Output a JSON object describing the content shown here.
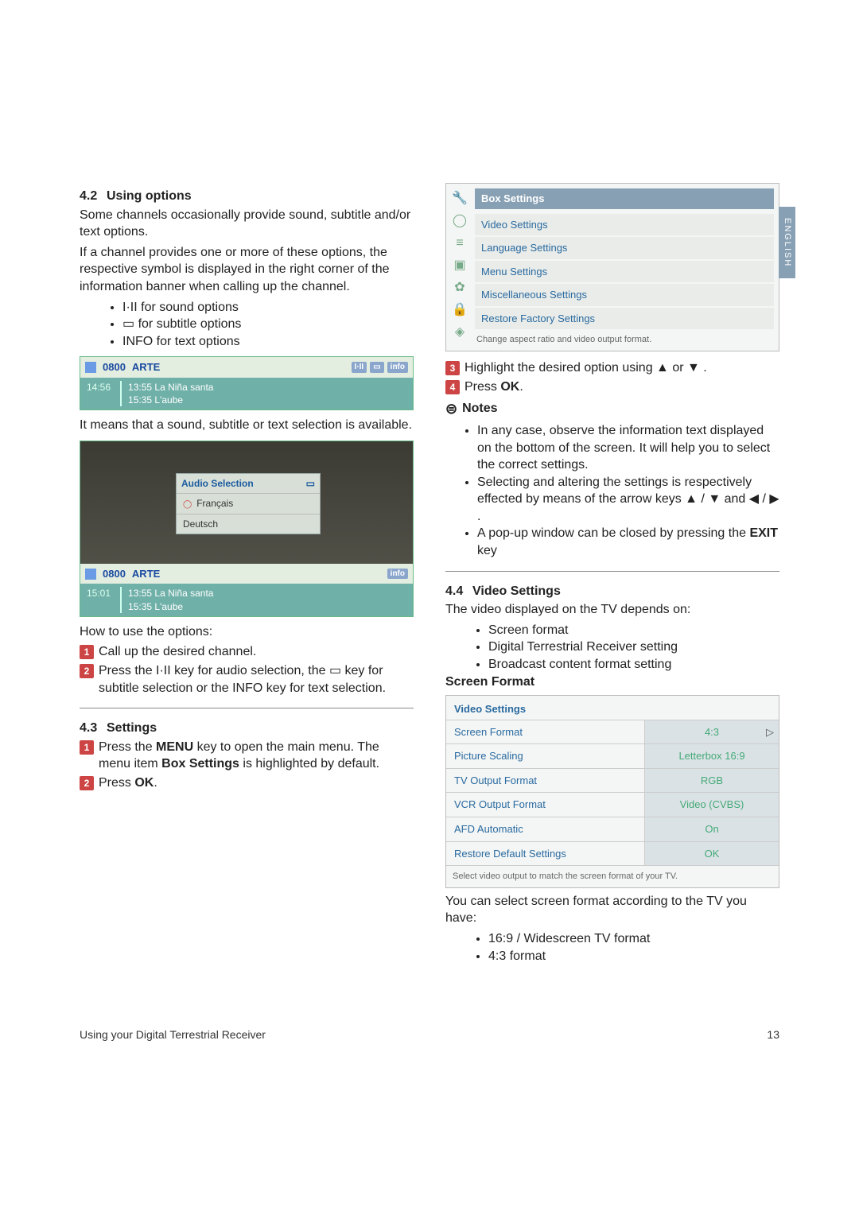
{
  "side_tab": "ENGLISH",
  "sec42": {
    "num": "4.2",
    "title": "Using options",
    "p1": "Some channels occasionally provide sound, subtitle and/or text options.",
    "p2": "If a channel provides one or more of these options, the respective symbol is displayed in the right corner of the information banner when calling up the channel.",
    "b1_pre": "I·II",
    "b1": " for sound options",
    "b2_pre": "▭",
    "b2": " for subtitle options",
    "b3": "INFO for text options",
    "after": "It means that a sound, subtitle or text selection is available.",
    "howto": "How to use the options:",
    "s1": "Call up the desired channel.",
    "s2a": "Press the ",
    "s2_key1": "I·II",
    "s2b": " key for audio selection, the ",
    "s2_key2": "▭",
    "s2c": " key for subtitle selection or the INFO key for text selection."
  },
  "banner": {
    "ch": "0800",
    "name": "ARTE",
    "tags": [
      "I·II",
      "▭",
      "info"
    ],
    "now_time": "14:56",
    "row1_time": "13:55",
    "row1_title": "La Niña santa",
    "row2_time": "15:35",
    "row2_title": "L'aube"
  },
  "audio": {
    "title": "Audio Selection",
    "opt1": "Français",
    "opt2": "Deutsch",
    "ch": "0800",
    "name": "ARTE",
    "tag": "info",
    "now_time": "15:01",
    "row1_time": "13:55",
    "row1_title": "La Niña santa",
    "row2_time": "15:35",
    "row2_title": "L'aube"
  },
  "sec43": {
    "num": "4.3",
    "title": "Settings",
    "s1a": "Press the ",
    "s1_menu": "MENU",
    "s1b": " key to open the main menu. The menu item ",
    "s1_box": "Box Settings",
    "s1c": " is highlighted by default.",
    "s2a": "Press ",
    "s2_ok": "OK",
    "s2b": "."
  },
  "box": {
    "title": "Box Settings",
    "items": [
      "Video Settings",
      "Language Settings",
      "Menu Settings",
      "Miscellaneous Settings",
      "Restore Factory Settings"
    ],
    "foot": "Change aspect ratio and video output format."
  },
  "right_steps": {
    "s3a": "Highlight the desired option using ",
    "s3_up": "▲",
    "s3_or": " or ",
    "s3_dn": "▼",
    "s3b": " .",
    "s4a": "Press ",
    "s4_ok": "OK",
    "s4b": "."
  },
  "notes": {
    "title": "Notes",
    "n1": "In any case, observe the information text displayed on the bottom of the screen. It will help you to select the correct settings.",
    "n2a": "Selecting and altering the settings is respectively effected by means of the arrow keys ",
    "n2_keys": "▲ / ▼ and ◀ / ▶",
    "n2b": " .",
    "n3a": "A pop-up window can be closed by pressing the ",
    "n3_exit": "EXIT",
    "n3b": " key"
  },
  "sec44": {
    "num": "4.4",
    "title": "Video Settings",
    "intro": "The video displayed on the TV depends on:",
    "b1": "Screen format",
    "b2": "Digital Terrestrial Receiver setting",
    "b3": "Broadcast content format setting",
    "subhead": "Screen Format"
  },
  "vs": {
    "title": "Video Settings",
    "rows": [
      {
        "lab": "Screen Format",
        "val": "4:3",
        "arrow": true
      },
      {
        "lab": "Picture Scaling",
        "val": "Letterbox 16:9"
      },
      {
        "lab": "TV Output Format",
        "val": "RGB"
      },
      {
        "lab": "VCR Output Format",
        "val": "Video (CVBS)"
      },
      {
        "lab": "AFD Automatic",
        "val": "On"
      },
      {
        "lab": "Restore Default Settings",
        "val": "OK"
      }
    ],
    "foot": "Select video output to match the screen format of your TV."
  },
  "after_vs": {
    "p": "You can select screen format according to the TV you have:",
    "b1": "16:9 / Widescreen TV format",
    "b2": "4:3 format"
  },
  "footer": {
    "left": "Using your Digital Terrestrial Receiver",
    "right": "13"
  }
}
